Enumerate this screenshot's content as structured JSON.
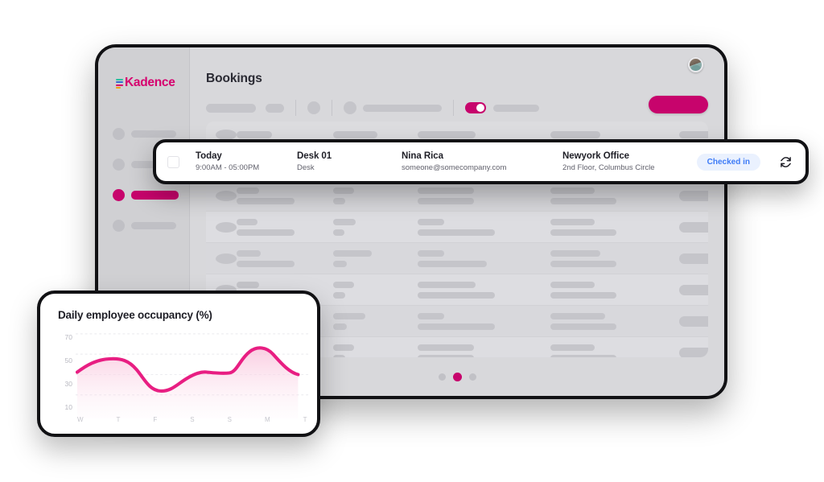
{
  "brand": {
    "name": "Kadence",
    "accent": "#c7046c",
    "logo_bar_colors": [
      "#2bbf9e",
      "#2f6fd0",
      "#d6006e",
      "#f0a000"
    ]
  },
  "app_window": {
    "page_title": "Bookings",
    "avatar_label": "user-avatar",
    "primary_button_label": "",
    "sidebar": {
      "items": [
        {
          "label": "",
          "active": false
        },
        {
          "label": "",
          "active": false
        },
        {
          "label": "",
          "active": true
        },
        {
          "label": "",
          "active": false
        }
      ]
    },
    "toolbar": {
      "toggle_on": true,
      "toggle_label": ""
    },
    "table": {
      "row_count": 7,
      "columns": [
        "",
        "",
        "",
        "",
        "",
        "",
        ""
      ]
    },
    "pagination": {
      "dots": 3,
      "active_index": 1
    }
  },
  "booking_card": {
    "checkbox_checked": false,
    "date_label": "Today",
    "time_range": "9:00AM - 05:00PM",
    "resource_name": "Desk 01",
    "resource_type": "Desk",
    "person_name": "Nina Rica",
    "person_email": "someone@somecompany.com",
    "office_name": "Newyork Office",
    "office_address": "2nd Floor, Columbus Circle",
    "status_badge": "Checked in",
    "status_badge_color": "#3d7bf7",
    "status_badge_bg": "#eaf1fe",
    "sync_icon": "refresh-icon"
  },
  "chart_data": {
    "type": "area",
    "title": "Daily employee occupancy (%)",
    "xlabel": "",
    "ylabel": "",
    "categories": [
      "W",
      "T",
      "F",
      "S",
      "S",
      "M",
      "T"
    ],
    "values": [
      32,
      48,
      15,
      27,
      34,
      60,
      29
    ],
    "series": [
      {
        "name": "Daily employee occupancy",
        "values": [
          32,
          48,
          15,
          27,
          34,
          60,
          29
        ],
        "color": "#e81e82"
      }
    ],
    "ylim": [
      0,
      80
    ],
    "yticks": [
      70,
      50,
      30,
      10
    ],
    "xticks": [
      "W",
      "T",
      "F",
      "S",
      "S",
      "M",
      "T"
    ],
    "grid": true,
    "grid_style": "dashed",
    "legend": false,
    "fill": true,
    "fill_color": "#fbe3ee",
    "line_color": "#e81e82",
    "line_width": 4
  }
}
